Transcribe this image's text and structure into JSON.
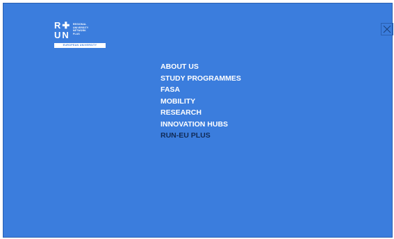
{
  "logo": {
    "mark_row1": "R✚",
    "mark_row2": "UN",
    "text_lines": [
      "REGIONAL",
      "UNIVERSITY",
      "NETWORK",
      "PLUS"
    ],
    "badge": "EUROPEAN UNIVERSITY"
  },
  "close": {
    "icon": "close-icon"
  },
  "menu": {
    "items": [
      {
        "label": "ABOUT US",
        "active": false
      },
      {
        "label": "STUDY PROGRAMMES",
        "active": false
      },
      {
        "label": "FASA",
        "active": false
      },
      {
        "label": "MOBILITY",
        "active": false
      },
      {
        "label": "RESEARCH",
        "active": false
      },
      {
        "label": "INNOVATION HUBS",
        "active": false
      },
      {
        "label": "RUN-EU PLUS",
        "active": true
      }
    ]
  },
  "colors": {
    "overlay_bg": "#3b7ddd",
    "nav_text": "#ffffff",
    "nav_active": "#102a56"
  }
}
